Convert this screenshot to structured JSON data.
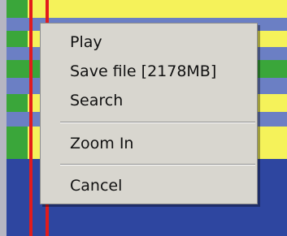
{
  "colors": {
    "yellow": "#f5f25a",
    "green": "#3aa63a",
    "blue_light": "#6b7fc4",
    "blue_dark": "#2e46a0",
    "grey_left": "#b6b6c2",
    "red_marker": "#e21b1b",
    "menu_background": "#d8d6cf"
  },
  "timeline": {
    "stripes": [
      {
        "color": "yellow",
        "green": true
      },
      {
        "color": "blue_light",
        "green": false
      },
      {
        "color": "yellow",
        "green": true
      },
      {
        "color": "blue_light",
        "green": false
      },
      {
        "color": "green",
        "green": true
      },
      {
        "color": "blue_light",
        "green": false
      },
      {
        "color": "yellow",
        "green": true
      },
      {
        "color": "blue_light",
        "green": false
      },
      {
        "color": "yellow",
        "green": true
      },
      {
        "color": "blue_dark",
        "green": false
      },
      {
        "color": "blue_dark",
        "green": false
      },
      {
        "color": "blue_dark",
        "green": false
      }
    ]
  },
  "context_menu": {
    "items": [
      {
        "label": "Play"
      },
      {
        "label": "Save file [2178MB]"
      },
      {
        "label": "Search"
      },
      {
        "label": "Zoom In"
      },
      {
        "label": "Cancel"
      }
    ]
  }
}
